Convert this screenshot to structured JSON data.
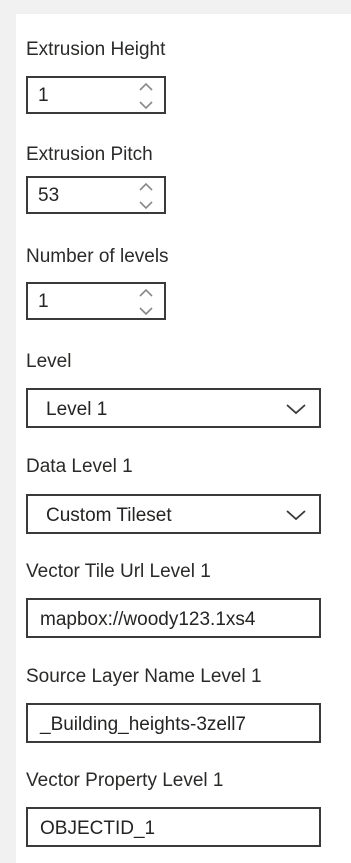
{
  "fields": {
    "extrusion_height": {
      "label": "Extrusion Height",
      "value": "1"
    },
    "extrusion_pitch": {
      "label": "Extrusion Pitch",
      "value": "53"
    },
    "number_of_levels": {
      "label": "Number of levels",
      "value": "1"
    },
    "level": {
      "label": "Level",
      "value": "Level 1"
    },
    "data_level_1": {
      "label": "Data Level 1",
      "value": "Custom Tileset"
    },
    "vector_tile_url_level_1": {
      "label": "Vector Tile Url Level 1",
      "value": "mapbox://woody123.1xs4"
    },
    "source_layer_name_level_1": {
      "label": "Source Layer Name Level 1",
      "value": "_Building_heights-3zell7"
    },
    "vector_property_level_1": {
      "label": "Vector Property Level 1",
      "value": "OBJECTID_1"
    }
  },
  "icons": {
    "spinner": "spinner-up-down-icon",
    "dropdown": "chevron-down-icon"
  },
  "colors": {
    "background": "#f1f1f1",
    "panel": "#ffffff",
    "border": "#3a3a3a",
    "text": "#252423"
  }
}
